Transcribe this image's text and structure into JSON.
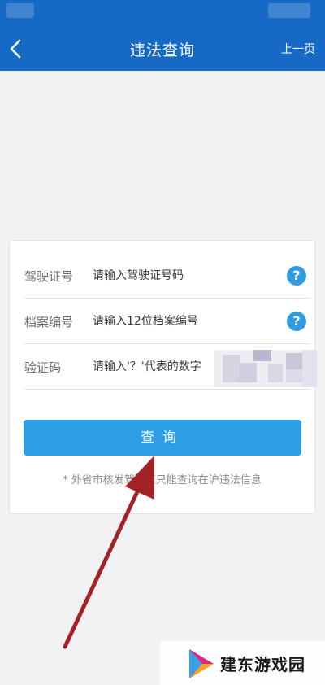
{
  "colors": {
    "header_blue": "#1769c6",
    "button_blue": "#2c9ee6",
    "help_icon_blue": "#2f9be0",
    "arrow_red": "#a32226"
  },
  "header": {
    "title": "违法查询",
    "back_icon": "chevron-left-icon",
    "right_label": "上一页"
  },
  "form": {
    "rows": [
      {
        "label": "驾驶证号",
        "placeholder": "请输入驾驶证号码",
        "help_icon": "question-icon",
        "help_symbol": "?"
      },
      {
        "label": "档案编号",
        "placeholder": "请输入12位档案编号",
        "help_icon": "question-icon",
        "help_symbol": "?"
      },
      {
        "label": "验证码",
        "placeholder": "请输入'？'代表的数字"
      }
    ],
    "submit_label": "查询",
    "note": "* 外省市核发驾驶证只能查询在沪违法信息"
  },
  "watermark": {
    "text": "建东游戏园"
  }
}
